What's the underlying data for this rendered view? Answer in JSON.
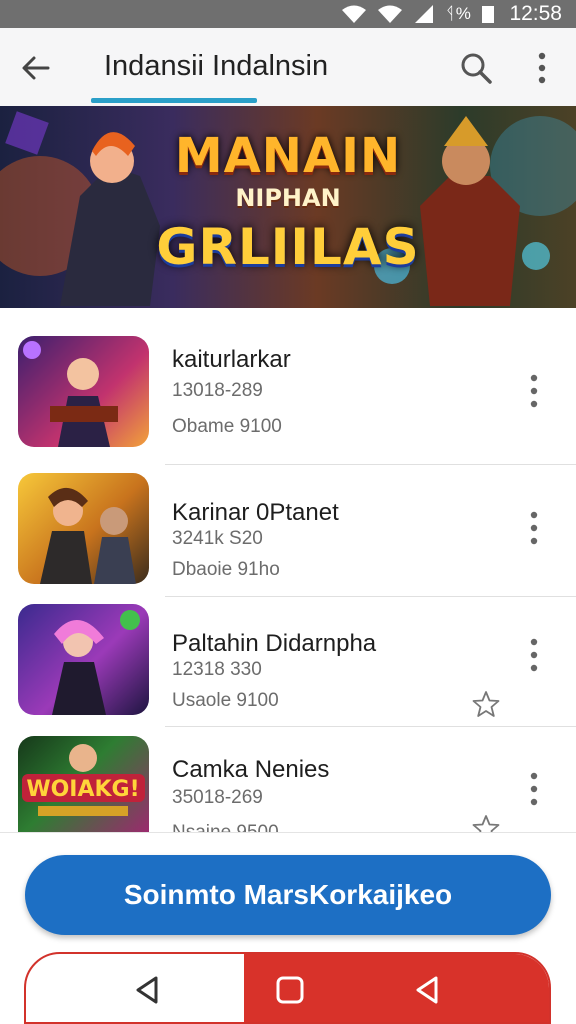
{
  "status_bar": {
    "battery_text": "ᛩ%",
    "time": "12:58"
  },
  "app_bar": {
    "title": "Indansii Indalnsin"
  },
  "banner": {
    "line1": "MANAIN",
    "line2": "NIPHAN",
    "line3": "GRLIILAS"
  },
  "items": [
    {
      "title": "kaiturlarkar",
      "subtitle": "13018-289",
      "meta": "Obame 9100",
      "starred": false
    },
    {
      "title": "Karinar 0Ptanet",
      "subtitle": "3241k S20",
      "meta": "Dbaoie 91ho",
      "starred": false
    },
    {
      "title": "Paltahin Didarnpha",
      "subtitle": "12318 330",
      "meta": "Usaole 9100",
      "starred": true
    },
    {
      "title": "Camka Nenies",
      "subtitle": "35018-269",
      "meta": "Nsaine 9500",
      "starred": true
    }
  ],
  "primary_button": {
    "label": "Soinmto MarsKorkaijkeo"
  },
  "colors": {
    "accent": "#2a9fc8",
    "primary": "#1d6fc4",
    "nav_red": "#d8322a"
  }
}
